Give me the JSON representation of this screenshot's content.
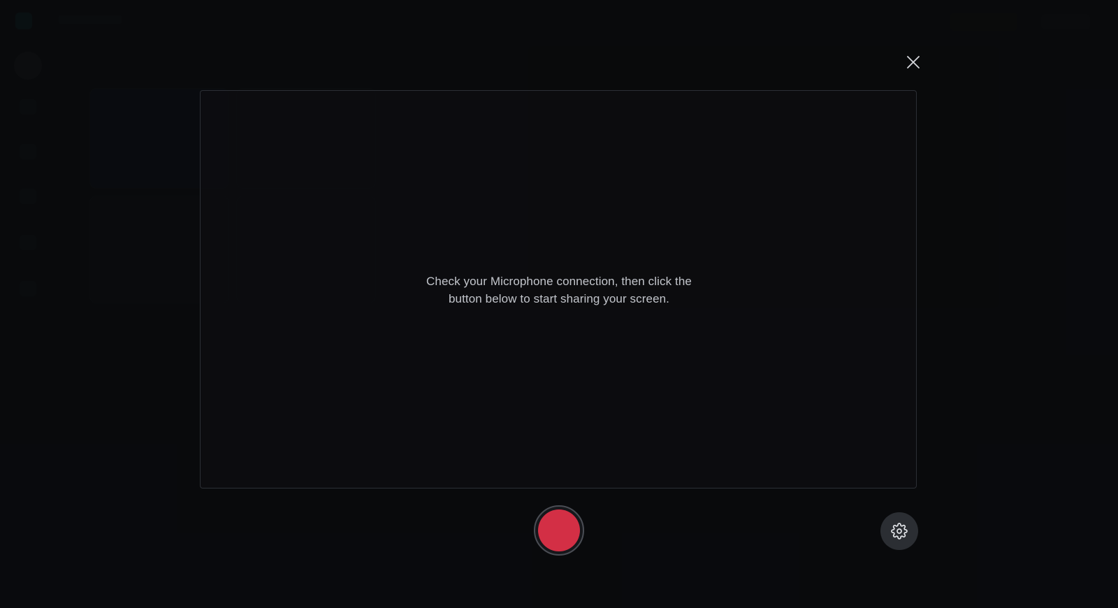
{
  "recorder": {
    "instruction_line1": "Check your Microphone connection, then click the",
    "instruction_line2": "button below to start sharing your screen.",
    "close_icon": "close-icon",
    "record_icon": "record-icon",
    "settings_icon": "gear-icon"
  },
  "colors": {
    "record_red": "#d32f45",
    "overlay_bg": "#0b0c0e",
    "text": "#c2c5cb"
  }
}
